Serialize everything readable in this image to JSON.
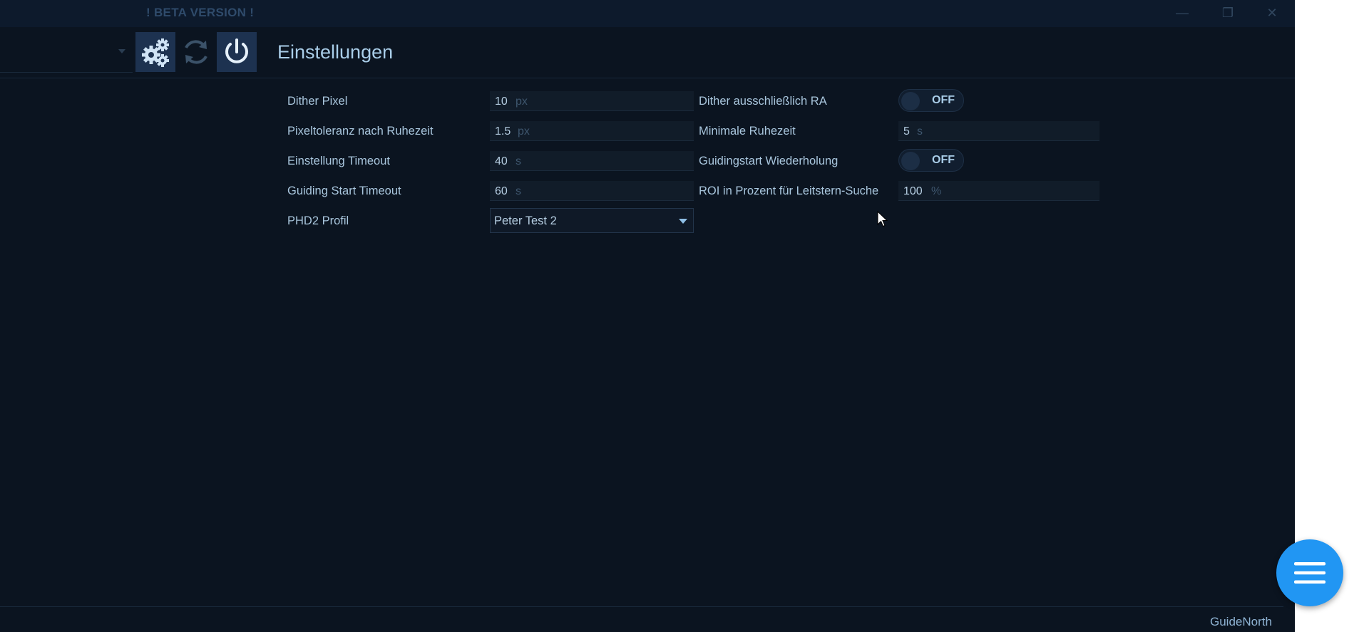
{
  "window": {
    "beta_label": "! BETA VERSION !",
    "minimize_icon": "minimize-icon",
    "maximize_icon": "maximize-icon",
    "close_icon": "close-icon"
  },
  "toolbar": {
    "profile_select_value": "",
    "buttons": [
      {
        "name": "settings",
        "icon": "gears-icon",
        "active": true
      },
      {
        "name": "refresh",
        "icon": "refresh-icon",
        "active": false
      },
      {
        "name": "power",
        "icon": "power-icon",
        "active": true
      }
    ]
  },
  "panel": {
    "title": "Einstellungen",
    "left_fields": [
      {
        "label": "Dither Pixel",
        "value": "10",
        "unit": "px"
      },
      {
        "label": "Pixeltoleranz nach Ruhezeit",
        "value": "1.5",
        "unit": "px"
      },
      {
        "label": "Einstellung Timeout",
        "value": "40",
        "unit": "s"
      },
      {
        "label": "Guiding Start Timeout",
        "value": "60",
        "unit": "s"
      }
    ],
    "profile": {
      "label": "PHD2 Profil",
      "selected": "Peter Test 2"
    },
    "right_fields": {
      "dither_ra": {
        "label": "Dither ausschließlich RA",
        "state": "OFF"
      },
      "min_settle": {
        "label": "Minimale Ruhezeit",
        "value": "5",
        "unit": "s"
      },
      "guiding_retry": {
        "label": "Guidingstart Wiederholung",
        "state": "OFF"
      },
      "roi": {
        "label": "ROI in Prozent für Leitstern-Suche",
        "value": "100",
        "unit": "%"
      }
    }
  },
  "footer": {
    "app_name": "GuideNorth",
    "fab_icon": "menu-icon"
  },
  "colors": {
    "background": "#0b1420",
    "accent": "#2196f3",
    "label_text": "#a9c6dd",
    "toolbar_active": "#1d3250"
  }
}
